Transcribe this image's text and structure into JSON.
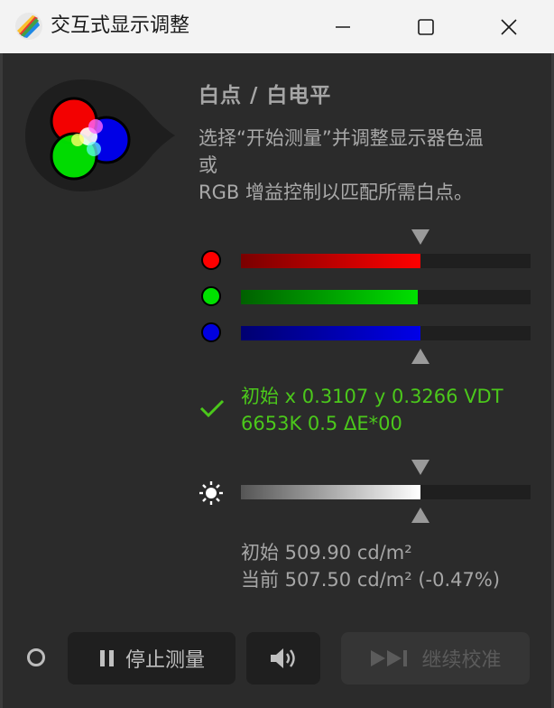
{
  "window": {
    "title": "交互式显示调整"
  },
  "panel": {
    "heading": "白点 / 白电平",
    "desc_line1": "选择“开始测量”并调整显示器色温",
    "desc_line2": "或",
    "desc_line3": "RGB 增益控制以匹配所需白点。"
  },
  "channels": {
    "red": {
      "color": "#ff0000",
      "level": 0.62
    },
    "green": {
      "color": "#00e000",
      "level": 0.61
    },
    "blue": {
      "color": "#0000e0",
      "level": 0.62
    }
  },
  "status": {
    "line1": "初始 x 0.3107 y 0.3266 VDT",
    "line2": "6653K 0.5 ΔE*00",
    "color": "#4bc81b"
  },
  "luminance": {
    "level": 0.62,
    "initial": "初始 509.90 cd/m²",
    "current": "当前 507.50 cd/m² (-0.47%)"
  },
  "buttons": {
    "stop_label": "停止测量",
    "continue_label": "继续校准"
  },
  "icons": {
    "app": "color-wheel-icon",
    "minimize": "minimize-icon",
    "maximize": "maximize-icon",
    "close": "close-icon",
    "check": "check-icon",
    "brightness": "sun-icon",
    "pause": "pause-icon",
    "sound": "speaker-icon",
    "skip": "skip-forward-icon",
    "indicator": "ring-icon"
  }
}
